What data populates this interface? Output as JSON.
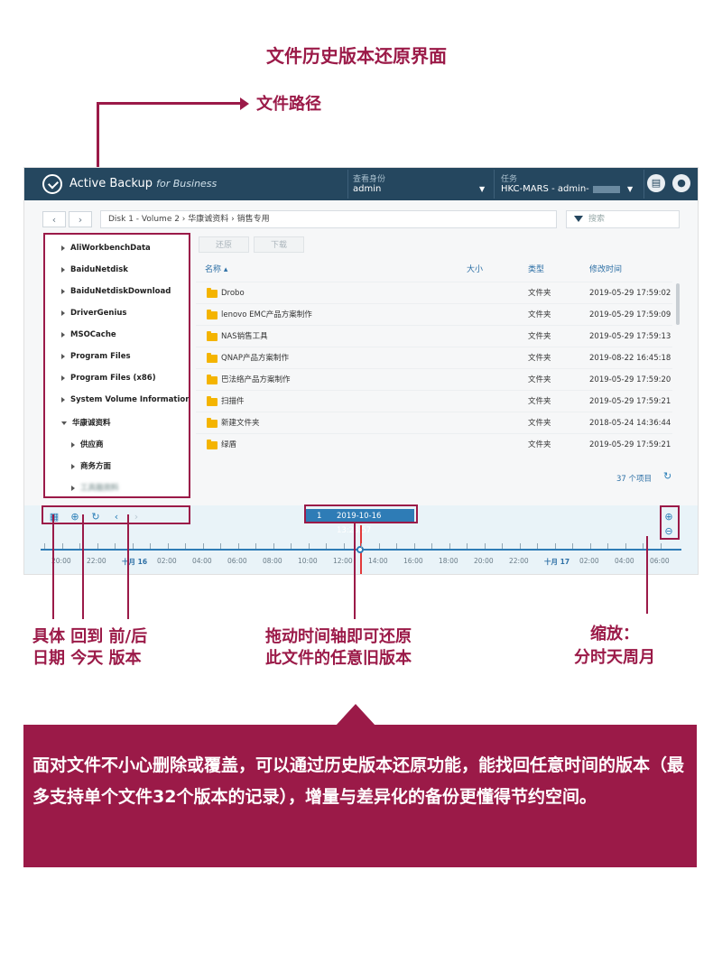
{
  "title": "文件历史版本还原界面",
  "annotations": {
    "path_label": "文件路径",
    "jump_date": "具体 回到 前/后\n日期 今天 版本",
    "drag_timeline": "拖动时间轴即可还原\n此文件的任意旧版本",
    "zoom": "缩放：\n分时天周月"
  },
  "app": {
    "brand_main": "Active Backup",
    "brand_sub": "for Business",
    "identity_label": "查看身份",
    "identity_value": "admin",
    "task_label": "任务",
    "task_value": "HKC-MARS - admin-",
    "breadcrumb": "Disk 1 - Volume 2  ›  华康诚资料  ›  销售专用",
    "search_placeholder": "搜索",
    "restore_btn": "还原",
    "download_btn": "下载",
    "tree": [
      {
        "label": "AliWorkbenchData",
        "level": 0,
        "open": false
      },
      {
        "label": "BaiduNetdisk",
        "level": 0,
        "open": false
      },
      {
        "label": "BaiduNetdiskDownload",
        "level": 0,
        "open": false
      },
      {
        "label": "DriverGenius",
        "level": 0,
        "open": false
      },
      {
        "label": "MSOCache",
        "level": 0,
        "open": false
      },
      {
        "label": "Program Files",
        "level": 0,
        "open": false
      },
      {
        "label": "Program Files (x86)",
        "level": 0,
        "open": false
      },
      {
        "label": "System Volume Information",
        "level": 0,
        "open": false
      },
      {
        "label": "华康诚资料",
        "level": 0,
        "open": true
      },
      {
        "label": "供应商",
        "level": 1,
        "open": false
      },
      {
        "label": "商务方面",
        "level": 1,
        "open": false
      },
      {
        "label": "工具箱资料",
        "level": 1,
        "open": false
      }
    ],
    "columns": {
      "name": "名称 ▴",
      "size": "大小",
      "type": "类型",
      "modified": "修改时间"
    },
    "rows": [
      {
        "name": "Drobo",
        "type": "文件夹",
        "modified": "2019-05-29 17:59:02"
      },
      {
        "name": "lenovo EMC产品方案制作",
        "type": "文件夹",
        "modified": "2019-05-29 17:59:09"
      },
      {
        "name": "NAS销售工具",
        "type": "文件夹",
        "modified": "2019-05-29 17:59:13"
      },
      {
        "name": "QNAP产品方案制作",
        "type": "文件夹",
        "modified": "2019-08-22 16:45:18"
      },
      {
        "name": "巴法络产品方案制作",
        "type": "文件夹",
        "modified": "2019-05-29 17:59:20"
      },
      {
        "name": "扫描件",
        "type": "文件夹",
        "modified": "2019-05-29 17:59:21"
      },
      {
        "name": "新建文件夹",
        "type": "文件夹",
        "modified": "2018-05-24 14:36:44"
      },
      {
        "name": "绿盾",
        "type": "文件夹",
        "modified": "2019-05-29 17:59:21"
      }
    ],
    "item_count": "37 个项目",
    "timeline_index": "1",
    "timeline_datetime": "2019-10-16 13:28:57",
    "timeline_labels": [
      "20:00",
      "22:00",
      "十月 16",
      "02:00",
      "04:00",
      "06:00",
      "08:00",
      "10:00",
      "12:00",
      "14:00",
      "16:00",
      "18:00",
      "20:00",
      "22:00",
      "十月 17",
      "02:00",
      "04:00",
      "06:00"
    ]
  },
  "banner": "面对文件不小心删除或覆盖，可以通过历史版本还原功能，能找回任意时间的版本（最多支持单个文件32个版本的记录），增量与差异化的备份更懂得节约空间。"
}
